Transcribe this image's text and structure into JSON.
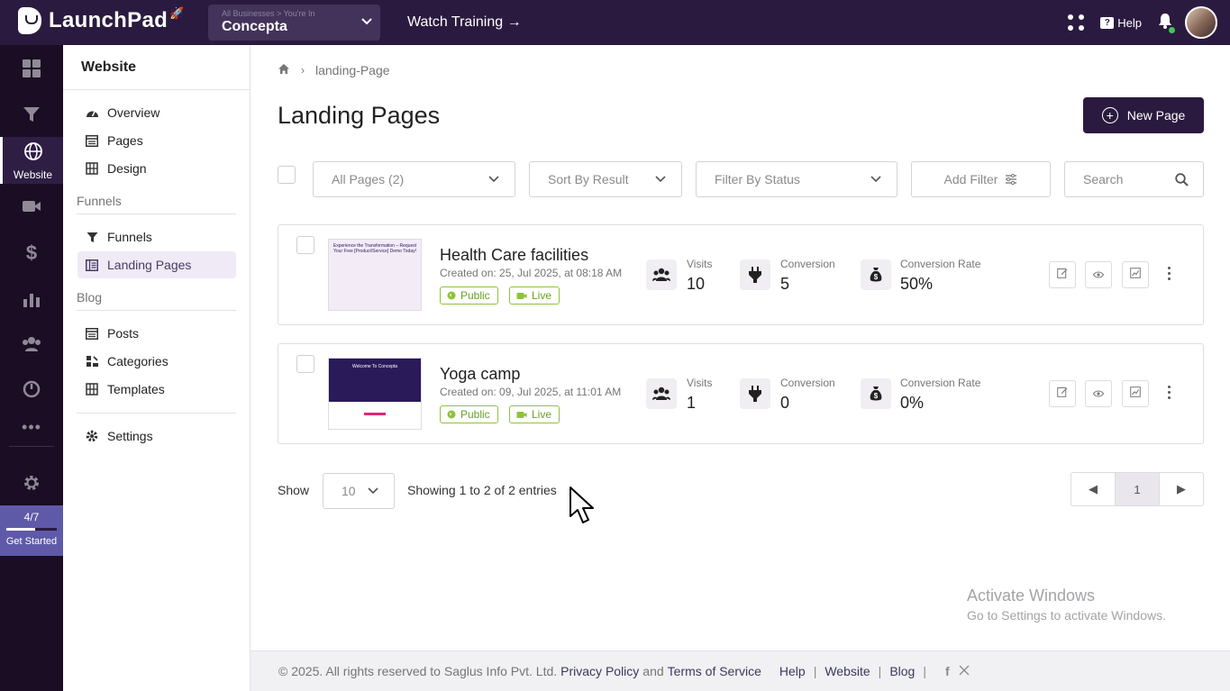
{
  "header": {
    "brand": "LaunchPad",
    "business_crumb": "All Businesses > You're In",
    "business_name": "Concepta",
    "watch_training": "Watch Training →",
    "help_label": "Help",
    "help_icon_text": "?"
  },
  "rail": {
    "active_label": "Website",
    "get_started": {
      "count": "4/7",
      "label": "Get Started",
      "progress": 0.57
    }
  },
  "sidebar": {
    "title": "Website",
    "items_website": [
      {
        "label": "Overview",
        "icon": "gauge-icon"
      },
      {
        "label": "Pages",
        "icon": "pages-icon"
      },
      {
        "label": "Design",
        "icon": "design-icon"
      }
    ],
    "section_funnels": "Funnels",
    "items_funnels": [
      {
        "label": "Funnels",
        "icon": "funnel-icon"
      },
      {
        "label": "Landing Pages",
        "icon": "landing-pages-icon",
        "active": true
      }
    ],
    "section_blog": "Blog",
    "items_blog": [
      {
        "label": "Posts",
        "icon": "posts-icon"
      },
      {
        "label": "Categories",
        "icon": "categories-icon"
      },
      {
        "label": "Templates",
        "icon": "templates-icon"
      }
    ],
    "settings": "Settings"
  },
  "main": {
    "breadcrumb_current": "landing-Page",
    "title": "Landing Pages",
    "new_button": "New Page",
    "filters": {
      "all_pages": "All Pages (2)",
      "sort": "Sort By Result",
      "status": "Filter By Status",
      "add_filter": "Add Filter",
      "search_placeholder": "Search"
    },
    "metric_labels": {
      "visits": "Visits",
      "conversion": "Conversion",
      "rate": "Conversion Rate"
    },
    "rows": [
      {
        "name": "Health Care facilities",
        "created": "Created on: 25, Jul 2025, at 08:18 AM",
        "tag_public": "Public",
        "tag_live": "Live",
        "visits": "10",
        "conversion": "5",
        "rate": "50%",
        "thumb_text": "Experience the Transformation – Request Your Free [Product/Service] Demo Today!"
      },
      {
        "name": "Yoga camp",
        "created": "Created on: 09, Jul 2025, at 11:01 AM",
        "tag_public": "Public",
        "tag_live": "Live",
        "visits": "1",
        "conversion": "0",
        "rate": "0%",
        "thumb_text": "Welcome To Concepta"
      }
    ],
    "pagination": {
      "show_label": "Show",
      "page_size": "10",
      "showing": "Showing 1 to 2 of 2 entries",
      "current_page": "1",
      "prev": "◀",
      "next": "▶"
    }
  },
  "watermark": {
    "line1": "Activate Windows",
    "line2": "Go to Settings to activate Windows."
  },
  "footer": {
    "copyright": "©  2025. All rights reserved to Saglus Info Pvt. Ltd.",
    "privacy": "Privacy Policy",
    "and": "and",
    "terms": "Terms of Service",
    "help": "Help",
    "website": "Website",
    "blog": "Blog",
    "sep": "|"
  },
  "colors": {
    "topbar": "#2b1a3f",
    "rail": "#1b0d24",
    "accent": "#2b1a3f",
    "tag_green": "#6aa024",
    "get_started": "#5f5aa8"
  }
}
